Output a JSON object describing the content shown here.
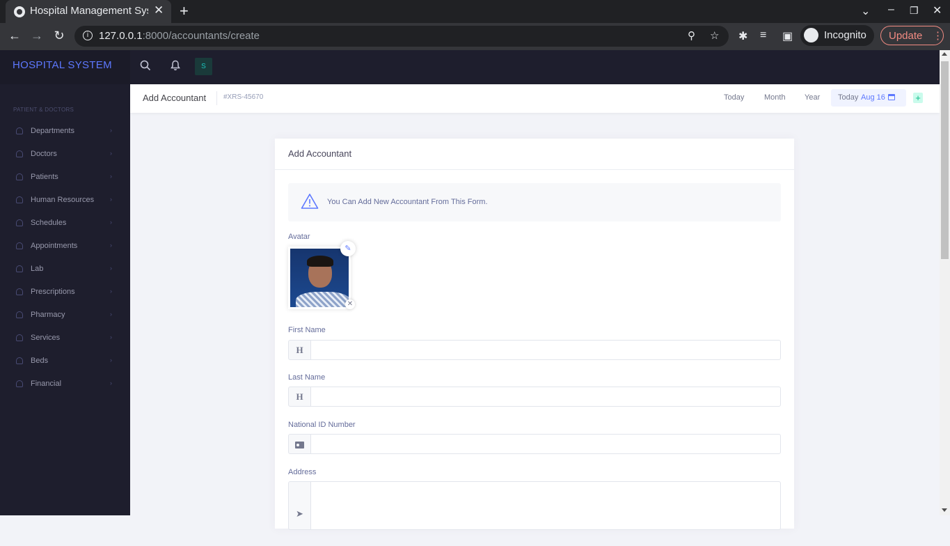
{
  "browser": {
    "tab_title": "Hospital Management System",
    "tab_close": "✕",
    "new_tab": "+",
    "url_host": "127.0.0.1",
    "url_path": ":8000/accountants/create",
    "profile_label": "Incognito",
    "update_label": "Update"
  },
  "sidebar": {
    "brand": "HOSPITAL SYSTEM",
    "section_title": "PATIENT & DOCTORS",
    "items": [
      {
        "label": "Departments"
      },
      {
        "label": "Doctors"
      },
      {
        "label": "Patients"
      },
      {
        "label": "Human Resources"
      },
      {
        "label": "Schedules"
      },
      {
        "label": "Appointments"
      },
      {
        "label": "Lab"
      },
      {
        "label": "Prescriptions"
      },
      {
        "label": "Pharmacy"
      },
      {
        "label": "Services"
      },
      {
        "label": "Beds"
      },
      {
        "label": "Financial"
      }
    ]
  },
  "topbar": {
    "user_initial": "S"
  },
  "subheader": {
    "title": "Add Accountant",
    "code": "#XRS-45670",
    "links": [
      "Today",
      "Month",
      "Year"
    ],
    "date_prefix": "Today",
    "date_value": "Aug 16",
    "plus": "+"
  },
  "card": {
    "title": "Add Accountant",
    "alert_text": "You Can Add New Accountant From This Form.",
    "avatar_label": "Avatar",
    "fields": {
      "first_name": {
        "label": "First Name",
        "value": "",
        "prefix": "H"
      },
      "last_name": {
        "label": "Last Name",
        "value": "",
        "prefix": "H"
      },
      "national_id": {
        "label": "National ID Number",
        "value": ""
      },
      "address": {
        "label": "Address",
        "value": ""
      }
    }
  },
  "colors": {
    "brand": "#5d78ff",
    "sidebar_bg": "#1e1e2d",
    "page_bg": "#f2f3f8",
    "accent_green": "#0abb87"
  }
}
